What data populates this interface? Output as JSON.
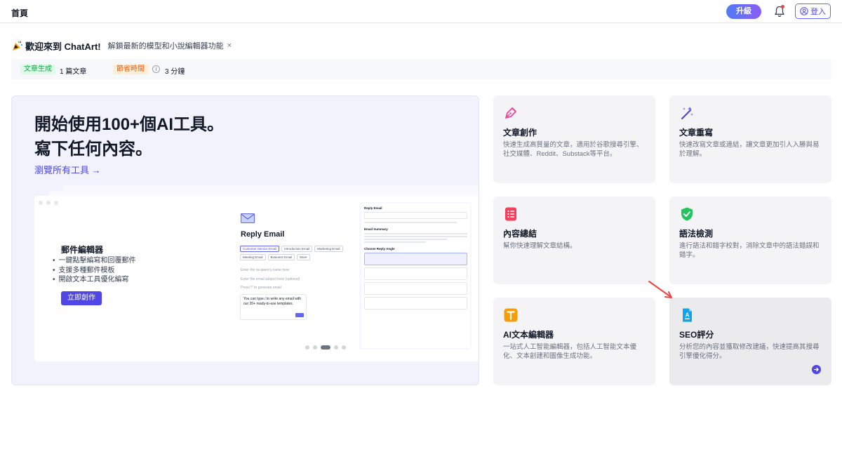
{
  "header": {
    "page_title": "首頁",
    "upgrade_label": "升級",
    "login_label": "登入"
  },
  "welcome": {
    "title": "歡迎來到 ChatArt!",
    "subtitle": "解鎖最新的模型和小說編輯器功能",
    "close": "×"
  },
  "stats": {
    "articles_label": "文章生成",
    "articles_value": "1 篇文章",
    "time_label": "節省時間",
    "info": "i",
    "time_value": "3 分鐘"
  },
  "hero": {
    "title_line1": "開始使用100+個AI工具。",
    "title_line2": "寫下任何內容。",
    "browse_link": "瀏覽所有工具 →",
    "feature_title": "郵件編輯器",
    "features": [
      "一鍵點擊編寫和回覆郵件",
      "支援多種郵件模板",
      "開啟文本工具優化編寫"
    ],
    "create_button": "立即創作",
    "mock": {
      "title": "Reply Email",
      "chips": [
        "Customer Service Email",
        "Introduction Email",
        "Marketing Email",
        "Meeting Email",
        "Business Email",
        "More"
      ],
      "field1": "Enter the recipient's name here",
      "field2": "Enter the email subject here (optional)",
      "field3": "Press\"/\" to generate email",
      "popup_text": "You can type / to write any email with our 20+ ready-to-use templates.",
      "right_title": "Reply Email",
      "right_summary": "Email Summary",
      "right_angle": "Choose Reply Angle"
    }
  },
  "tools": [
    {
      "title": "文章創作",
      "desc": "快速生成高質量的文章，適用於谷歌搜尋引擎、社交媒體、Reddit、Substack等平台。",
      "icon": "pen-nib-icon",
      "color": "#ec4899"
    },
    {
      "title": "文章重寫",
      "desc": "快速改寫文章或連結，讓文章更加引人入勝與易於理解。",
      "icon": "sparkles-icon",
      "color": "#4f46e5"
    },
    {
      "title": "內容總結",
      "desc": "幫你快速理解文章結構。",
      "icon": "list-icon",
      "color": "#f43f5e"
    },
    {
      "title": "語法檢測",
      "desc": "進行語法和錯字校對，消除文章中的語法錯誤和錯字。",
      "icon": "shield-check-icon",
      "color": "#22c55e"
    },
    {
      "title": "AI文本編輯器",
      "desc": "一站式人工智能編輯器，包括人工智能文本優化、文本創建和圖像生成功能。",
      "icon": "text-editor-icon",
      "color": "#f59e0b"
    },
    {
      "title": "SEO評分",
      "desc": "分析您的內容並獲取修改建議，快速提高其搜尋引擎優化得分。",
      "icon": "seo-doc-icon",
      "color": "#0ea5e9"
    }
  ]
}
